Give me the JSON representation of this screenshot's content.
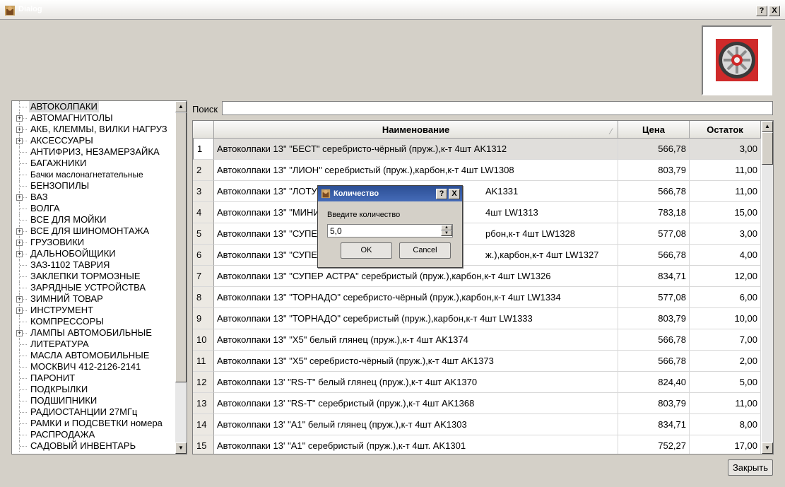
{
  "window": {
    "title": "Dialog",
    "help_label": "?",
    "close_label": "X"
  },
  "colors": {
    "accent": "#2c4f94",
    "logo_bg": "#d0282a"
  },
  "icons": {
    "app": "app-icon",
    "logo": "wheel-rim-logo"
  },
  "tree": {
    "items": [
      {
        "label": "АВТОКОЛПАКИ",
        "expandable": false,
        "selected": true
      },
      {
        "label": "АВТОМАГНИТОЛЫ",
        "expandable": true
      },
      {
        "label": "АКБ, КЛЕММЫ, ВИЛКИ НАГРУЗ",
        "expandable": true
      },
      {
        "label": "АКСЕССУАРЫ",
        "expandable": true
      },
      {
        "label": "АНТИФРИЗ, НЕЗАМЕРЗАЙКА",
        "expandable": false
      },
      {
        "label": "БАГАЖНИКИ",
        "expandable": false
      },
      {
        "label": "Бачки маслонагнетательные",
        "expandable": false,
        "small": true
      },
      {
        "label": "БЕНЗОПИЛЫ",
        "expandable": false
      },
      {
        "label": "ВАЗ",
        "expandable": true
      },
      {
        "label": "ВОЛГА",
        "expandable": false
      },
      {
        "label": "ВСЕ ДЛЯ МОЙКИ",
        "expandable": false
      },
      {
        "label": "ВСЕ ДЛЯ ШИНОМОНТАЖА",
        "expandable": true
      },
      {
        "label": "ГРУЗОВИКИ",
        "expandable": true
      },
      {
        "label": "ДАЛЬНОБОЙЩИКИ",
        "expandable": true
      },
      {
        "label": "ЗАЗ-1102 ТАВРИЯ",
        "expandable": false
      },
      {
        "label": "ЗАКЛЕПКИ ТОРМОЗНЫЕ",
        "expandable": false
      },
      {
        "label": "ЗАРЯДНЫЕ УСТРОЙСТВА",
        "expandable": false
      },
      {
        "label": "ЗИМНИЙ ТОВАР",
        "expandable": true
      },
      {
        "label": "ИНСТРУМЕНТ",
        "expandable": true
      },
      {
        "label": "КОМПРЕССОРЫ",
        "expandable": false
      },
      {
        "label": "ЛАМПЫ АВТОМОБИЛЬНЫЕ",
        "expandable": true
      },
      {
        "label": "ЛИТЕРАТУРА",
        "expandable": false
      },
      {
        "label": "МАСЛА АВТОМОБИЛЬНЫЕ",
        "expandable": false
      },
      {
        "label": "МОСКВИЧ 412-2126-2141",
        "expandable": false
      },
      {
        "label": "ПАРОНИТ",
        "expandable": false
      },
      {
        "label": "ПОДКРЫЛКИ",
        "expandable": false
      },
      {
        "label": "ПОДШИПНИКИ",
        "expandable": false
      },
      {
        "label": "РАДИОСТАНЦИИ 27МГц",
        "expandable": false
      },
      {
        "label": "РАМКИ и ПОДСВЕТКИ номера",
        "expandable": false
      },
      {
        "label": "РАСПРОДАЖА",
        "expandable": false
      },
      {
        "label": "САДОВЫЙ ИНВЕНТАРЬ",
        "expandable": false
      }
    ]
  },
  "search": {
    "label": "Поиск",
    "value": ""
  },
  "table": {
    "columns": [
      "Наименование",
      "Цена",
      "Остаток"
    ],
    "sort_indicator": "⁄",
    "current_row": 1,
    "rows": [
      {
        "n": "1",
        "name": "Автоколпаки 13\" \"БЕСТ\" серебристо-чёрный (пруж.),к-т 4шт  AK1312",
        "price": "566,78",
        "stock": "3,00"
      },
      {
        "n": "2",
        "name": "Автоколпаки 13\" \"ЛИОН\" серебристый (пруж.),карбон,к-т 4шт  LW1308",
        "price": "803,79",
        "stock": "11,00"
      },
      {
        "n": "3",
        "name": "Автоколпаки 13\" \"ЛОТУ",
        "name_tail": "AK1331",
        "price": "566,78",
        "stock": "11,00"
      },
      {
        "n": "4",
        "name": "Автоколпаки 13\" \"МИНИ",
        "name_tail": "4шт  LW1313",
        "price": "783,18",
        "stock": "15,00"
      },
      {
        "n": "5",
        "name": "Автоколпаки 13\" \"СУПЕ",
        "name_tail": "рбон,к-т 4шт   LW1328",
        "price": "577,08",
        "stock": "3,00"
      },
      {
        "n": "6",
        "name": "Автоколпаки 13\" \"СУПЕ",
        "name_tail": "ж.),карбон,к-т 4шт  LW1327",
        "price": "566,78",
        "stock": "4,00"
      },
      {
        "n": "7",
        "name": "Автоколпаки 13\" \"СУПЕР АСТРА\" серебристый (пруж.),карбон,к-т 4шт  LW1326",
        "price": "834,71",
        "stock": "12,00"
      },
      {
        "n": "8",
        "name": "Автоколпаки 13\" \"ТОРНАДО\" серебристо-чёрный (пруж.),карбон,к-т 4шт   LW1334",
        "price": "577,08",
        "stock": "6,00"
      },
      {
        "n": "9",
        "name": "Автоколпаки 13\" \"ТОРНАДО\" серебристый (пруж.),карбон,к-т 4шт  LW1333",
        "price": "803,79",
        "stock": "10,00"
      },
      {
        "n": "10",
        "name": "Автоколпаки 13\" \"X5\" белый глянец (пруж.),к-т 4шт  AK1374",
        "price": "566,78",
        "stock": "7,00"
      },
      {
        "n": "11",
        "name": "Автоколпаки 13\" \"X5\" серебристо-чёрный (пруж.),к-т 4шт  AK1373",
        "price": "566,78",
        "stock": "2,00"
      },
      {
        "n": "12",
        "name": "Автоколпаки 13' \"RS-T\" белый глянец (пруж.),к-т 4шт  AK1370",
        "price": "824,40",
        "stock": "5,00"
      },
      {
        "n": "13",
        "name": "Автоколпаки 13' \"RS-T\" серебристый (пруж.),к-т 4шт  AK1368",
        "price": "803,79",
        "stock": "11,00"
      },
      {
        "n": "14",
        "name": "Автоколпаки 13' \"A1\" белый глянец (пруж.),к-т 4шт  AK1303",
        "price": "834,71",
        "stock": "8,00"
      },
      {
        "n": "15",
        "name": "Автоколпаки 13' \"A1\" серебристый (пруж.),к-т 4шт.  AK1301",
        "price": "752,27",
        "stock": "17,00"
      }
    ]
  },
  "close_button": {
    "label": "Закрыть"
  },
  "quantity_dialog": {
    "title": "Количество",
    "help_label": "?",
    "close_label": "X",
    "prompt": "Введите количество",
    "value": "5,0",
    "ok_label": "OK",
    "cancel_label": "Cancel"
  }
}
